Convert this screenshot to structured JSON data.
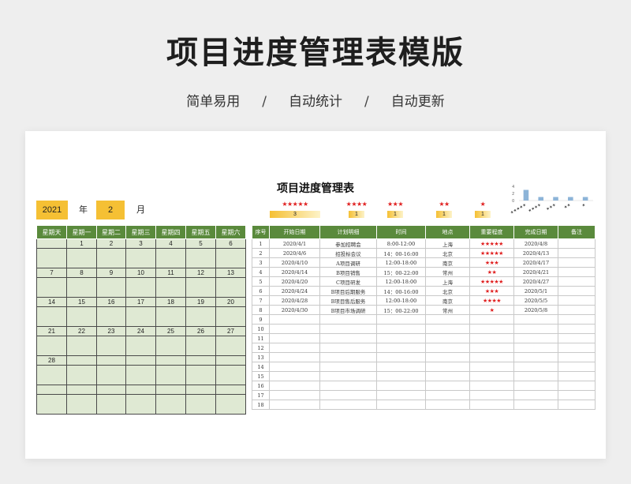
{
  "header": {
    "title": "项目进度管理表模版",
    "features": [
      "简单易用",
      "自动统计",
      "自动更新"
    ],
    "separator": "/"
  },
  "sheet": {
    "title": "项目进度管理表",
    "year_value": "2021",
    "year_unit": "年",
    "month_value": "2",
    "month_unit": "月"
  },
  "calendar": {
    "weekdays": [
      "星期天",
      "星期一",
      "星期二",
      "星期三",
      "星期四",
      "星期五",
      "星期六"
    ],
    "weeks": [
      [
        "",
        "1",
        "2",
        "3",
        "4",
        "5",
        "6"
      ],
      [
        "7",
        "8",
        "9",
        "10",
        "11",
        "12",
        "13"
      ],
      [
        "14",
        "15",
        "16",
        "17",
        "18",
        "19",
        "20"
      ],
      [
        "21",
        "22",
        "23",
        "24",
        "25",
        "26",
        "27"
      ],
      [
        "28",
        "",
        "",
        "",
        "",
        "",
        ""
      ],
      [
        "",
        "",
        "",
        "",
        "",
        "",
        ""
      ]
    ]
  },
  "star_summary": [
    {
      "stars": "★★★★★",
      "count": "3",
      "fill": 1.0
    },
    {
      "stars": "★★★★",
      "count": "1",
      "fill": 0.33
    },
    {
      "stars": "★★★",
      "count": "1",
      "fill": 0.33
    },
    {
      "stars": "★★",
      "count": "1",
      "fill": 0.33
    },
    {
      "stars": "★",
      "count": "1",
      "fill": 0.33
    }
  ],
  "mini_chart": {
    "y_ticks": [
      "4",
      "2",
      "0"
    ],
    "values": [
      3,
      1,
      1,
      1,
      1
    ],
    "ymax": 4,
    "bar_color": "#8db4d8",
    "categories": [
      "★★★★★",
      "★★★★",
      "★★★",
      "★★",
      "★"
    ]
  },
  "projects": {
    "headers": [
      "序号",
      "开始日期",
      "计划明细",
      "时间",
      "地点",
      "重要程度",
      "完成日期",
      "备注"
    ],
    "rows": [
      [
        "1",
        "2020/4/1",
        "参加招聘会",
        "8:00-12:00",
        "上海",
        "★★★★★",
        "2020/4/8",
        ""
      ],
      [
        "2",
        "2020/4/6",
        "招投标会议",
        "14：00-16:00",
        "北京",
        "★★★★★",
        "2020/4/13",
        ""
      ],
      [
        "3",
        "2020/4/10",
        "A项目调研",
        "12:00-18:00",
        "南京",
        "★★★",
        "2020/4/17",
        ""
      ],
      [
        "4",
        "2020/4/14",
        "B项目销售",
        "15：00-22:00",
        "常州",
        "★★",
        "2020/4/21",
        ""
      ],
      [
        "5",
        "2020/4/20",
        "C项目研发",
        "12:00-18:00",
        "上海",
        "★★★★★",
        "2020/4/27",
        ""
      ],
      [
        "6",
        "2020/4/24",
        "B项目后期服务",
        "14：00-16:00",
        "北京",
        "★★★",
        "2020/5/1",
        ""
      ],
      [
        "7",
        "2020/4/28",
        "B项目售后服务",
        "12:00-18:00",
        "南京",
        "★★★★",
        "2020/5/5",
        ""
      ],
      [
        "8",
        "2020/4/30",
        "B项目市场调研",
        "15：00-22:00",
        "常州",
        "★",
        "2020/5/8",
        ""
      ],
      [
        "9",
        "",
        "",
        "",
        "",
        "",
        "",
        ""
      ],
      [
        "10",
        "",
        "",
        "",
        "",
        "",
        "",
        ""
      ],
      [
        "11",
        "",
        "",
        "",
        "",
        "",
        "",
        ""
      ],
      [
        "12",
        "",
        "",
        "",
        "",
        "",
        "",
        ""
      ],
      [
        "13",
        "",
        "",
        "",
        "",
        "",
        "",
        ""
      ],
      [
        "14",
        "",
        "",
        "",
        "",
        "",
        "",
        ""
      ],
      [
        "15",
        "",
        "",
        "",
        "",
        "",
        "",
        ""
      ],
      [
        "16",
        "",
        "",
        "",
        "",
        "",
        "",
        ""
      ],
      [
        "17",
        "",
        "",
        "",
        "",
        "",
        "",
        ""
      ],
      [
        "18",
        "",
        "",
        "",
        "",
        "",
        "",
        ""
      ]
    ]
  }
}
